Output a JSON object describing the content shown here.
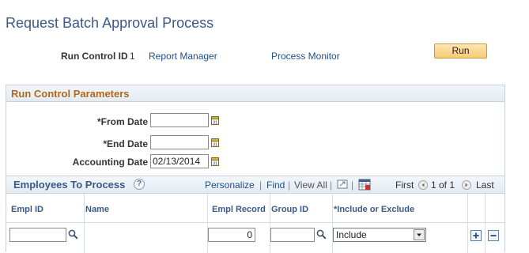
{
  "page": {
    "title": "Request Batch Approval Process"
  },
  "run_control": {
    "label": "Run Control ID",
    "value": "1",
    "report_manager": "Report Manager",
    "process_monitor": "Process Monitor",
    "run_label": "Run"
  },
  "parameters": {
    "title": "Run Control Parameters",
    "from_date": {
      "label": "*From Date",
      "value": ""
    },
    "end_date": {
      "label": "*End Date",
      "value": ""
    },
    "accounting_date": {
      "label": "Accounting Date",
      "value": "02/13/2014"
    }
  },
  "grid": {
    "title": "Employees To Process",
    "toolbar": {
      "personalize": "Personalize",
      "find": "Find",
      "view_all": "View All",
      "first": "First",
      "range": "1 of 1",
      "last": "Last"
    },
    "columns": [
      "Empl ID",
      "Name",
      "Empl Record",
      "Group ID",
      "*Include or Exclude"
    ],
    "rows": [
      {
        "empl_id": "",
        "name": "",
        "empl_record": "0",
        "group_id": "",
        "include_or_exclude": "Include"
      }
    ]
  },
  "icons": {
    "calendar": "calendar-icon",
    "lookup": "magnifier-lookup-icon",
    "help": "help-icon",
    "zoom": "zoom-icon",
    "download": "download-grid-icon",
    "add_row": "plus-icon",
    "delete_row": "minus-icon"
  },
  "colors": {
    "title": "#3a5a86",
    "section_title": "#b3671a",
    "link": "#20518a",
    "run_button": "#f6cb74"
  }
}
